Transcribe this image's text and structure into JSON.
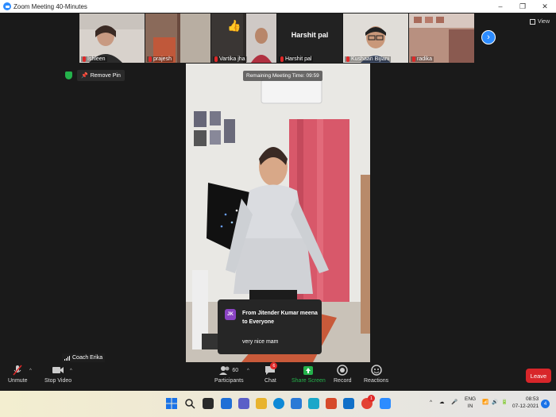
{
  "window": {
    "title": "Zoom Meeting 40-Minutes",
    "controls": [
      "–",
      "❐",
      "✕"
    ]
  },
  "participants_strip": [
    {
      "name": "Ishleen"
    },
    {
      "name": "prajesh"
    },
    {
      "name": "Vartika jha"
    },
    {
      "name": "Harshit pal",
      "big_label": "Harshit pal"
    },
    {
      "name": "Kushaan Bijlani"
    },
    {
      "name": "radika"
    }
  ],
  "view_button": {
    "label": "View"
  },
  "remove_pin": {
    "label": "Remove Pin"
  },
  "meeting": {
    "remaining_time": "Remaining Meeting Time: 09:59"
  },
  "chat_popup": {
    "initials": "JK",
    "from": "From Jitender Kumar meena to Everyone",
    "message": "very nice mam"
  },
  "active_speaker": {
    "name": "Coach Erika"
  },
  "toolbar": {
    "unmute": "Unmute",
    "stop_video": "Stop Video",
    "participants": "Participants",
    "participants_count": "60",
    "chat": "Chat",
    "chat_badge": "6",
    "share_screen": "Share Screen",
    "record": "Record",
    "reactions": "Reactions",
    "leave": "Leave"
  },
  "taskbar": {
    "lang": "ENG",
    "region": "IN",
    "time": "08:53",
    "date": "07-12-2021",
    "notif_count": "4",
    "extra_badge": "1"
  },
  "colors": {
    "zoom_blue": "#2d8cff",
    "leave_red": "#d8262a",
    "share_green": "#24b24b",
    "chat_avatar": "#8b44c4"
  }
}
